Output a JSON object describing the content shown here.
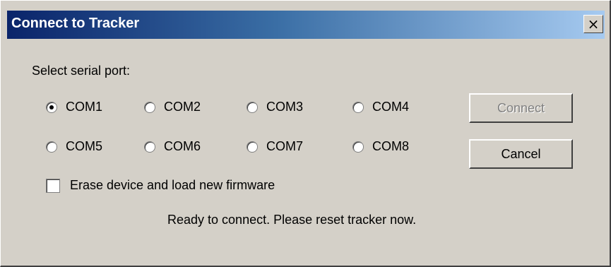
{
  "window": {
    "title": "Connect to Tracker",
    "close_glyph": "×"
  },
  "port_label": "Select serial port:",
  "ports": [
    {
      "label": "COM1",
      "selected": true
    },
    {
      "label": "COM2",
      "selected": false
    },
    {
      "label": "COM3",
      "selected": false
    },
    {
      "label": "COM4",
      "selected": false
    },
    {
      "label": "COM5",
      "selected": false
    },
    {
      "label": "COM6",
      "selected": false
    },
    {
      "label": "COM7",
      "selected": false
    },
    {
      "label": "COM8",
      "selected": false
    }
  ],
  "erase_checkbox": {
    "label": "Erase device and load new firmware",
    "checked": false
  },
  "buttons": {
    "connect": "Connect",
    "cancel": "Cancel"
  },
  "status": "Ready to connect.  Please reset tracker now."
}
